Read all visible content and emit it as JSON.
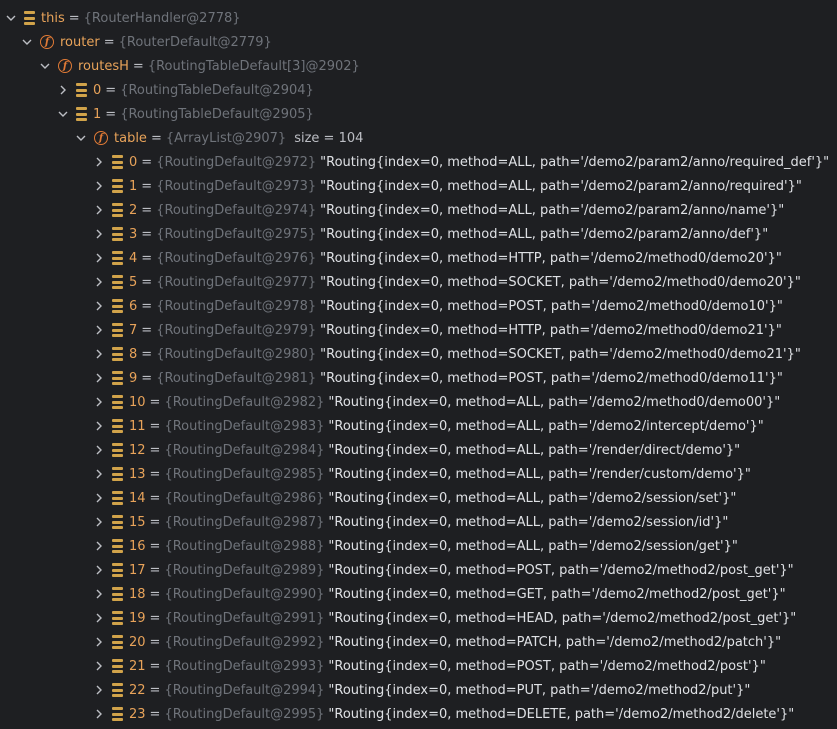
{
  "nodes": [
    {
      "label": "this",
      "ref": "{RouterHandler@2778}"
    },
    {
      "label": "router",
      "ref": "{RouterDefault@2779}"
    },
    {
      "label": "routesH",
      "ref": "{RoutingTableDefault[3]@2902}"
    },
    {
      "label": "0",
      "ref": "{RoutingTableDefault@2904}"
    },
    {
      "label": "1",
      "ref": "{RoutingTableDefault@2905}"
    },
    {
      "label": "table",
      "ref": "{ArrayList@2907}",
      "size": "size = 104"
    }
  ],
  "items": [
    {
      "index": "0",
      "ref": "{RoutingDefault@2972}",
      "value": "\"Routing{index=0, method=ALL, path='/demo2/param2/anno/required_def'}\""
    },
    {
      "index": "1",
      "ref": "{RoutingDefault@2973}",
      "value": "\"Routing{index=0, method=ALL, path='/demo2/param2/anno/required'}\""
    },
    {
      "index": "2",
      "ref": "{RoutingDefault@2974}",
      "value": "\"Routing{index=0, method=ALL, path='/demo2/param2/anno/name'}\""
    },
    {
      "index": "3",
      "ref": "{RoutingDefault@2975}",
      "value": "\"Routing{index=0, method=ALL, path='/demo2/param2/anno/def'}\""
    },
    {
      "index": "4",
      "ref": "{RoutingDefault@2976}",
      "value": "\"Routing{index=0, method=HTTP, path='/demo2/method0/demo20'}\""
    },
    {
      "index": "5",
      "ref": "{RoutingDefault@2977}",
      "value": "\"Routing{index=0, method=SOCKET, path='/demo2/method0/demo20'}\""
    },
    {
      "index": "6",
      "ref": "{RoutingDefault@2978}",
      "value": "\"Routing{index=0, method=POST, path='/demo2/method0/demo10'}\""
    },
    {
      "index": "7",
      "ref": "{RoutingDefault@2979}",
      "value": "\"Routing{index=0, method=HTTP, path='/demo2/method0/demo21'}\""
    },
    {
      "index": "8",
      "ref": "{RoutingDefault@2980}",
      "value": "\"Routing{index=0, method=SOCKET, path='/demo2/method0/demo21'}\""
    },
    {
      "index": "9",
      "ref": "{RoutingDefault@2981}",
      "value": "\"Routing{index=0, method=POST, path='/demo2/method0/demo11'}\""
    },
    {
      "index": "10",
      "ref": "{RoutingDefault@2982}",
      "value": "\"Routing{index=0, method=ALL, path='/demo2/method0/demo00'}\""
    },
    {
      "index": "11",
      "ref": "{RoutingDefault@2983}",
      "value": "\"Routing{index=0, method=ALL, path='/demo2/intercept/demo'}\""
    },
    {
      "index": "12",
      "ref": "{RoutingDefault@2984}",
      "value": "\"Routing{index=0, method=ALL, path='/render/direct/demo'}\""
    },
    {
      "index": "13",
      "ref": "{RoutingDefault@2985}",
      "value": "\"Routing{index=0, method=ALL, path='/render/custom/demo'}\""
    },
    {
      "index": "14",
      "ref": "{RoutingDefault@2986}",
      "value": "\"Routing{index=0, method=ALL, path='/demo2/session/set'}\""
    },
    {
      "index": "15",
      "ref": "{RoutingDefault@2987}",
      "value": "\"Routing{index=0, method=ALL, path='/demo2/session/id'}\""
    },
    {
      "index": "16",
      "ref": "{RoutingDefault@2988}",
      "value": "\"Routing{index=0, method=ALL, path='/demo2/session/get'}\""
    },
    {
      "index": "17",
      "ref": "{RoutingDefault@2989}",
      "value": "\"Routing{index=0, method=POST, path='/demo2/method2/post_get'}\""
    },
    {
      "index": "18",
      "ref": "{RoutingDefault@2990}",
      "value": "\"Routing{index=0, method=GET, path='/demo2/method2/post_get'}\""
    },
    {
      "index": "19",
      "ref": "{RoutingDefault@2991}",
      "value": "\"Routing{index=0, method=HEAD, path='/demo2/method2/post_get'}\""
    },
    {
      "index": "20",
      "ref": "{RoutingDefault@2992}",
      "value": "\"Routing{index=0, method=PATCH, path='/demo2/method2/patch'}\""
    },
    {
      "index": "21",
      "ref": "{RoutingDefault@2993}",
      "value": "\"Routing{index=0, method=POST, path='/demo2/method2/post'}\""
    },
    {
      "index": "22",
      "ref": "{RoutingDefault@2994}",
      "value": "\"Routing{index=0, method=PUT, path='/demo2/method2/put'}\""
    },
    {
      "index": "23",
      "ref": "{RoutingDefault@2995}",
      "value": "\"Routing{index=0, method=DELETE, path='/demo2/method2/delete'}\""
    }
  ],
  "colors": {
    "background": "#1e1f22",
    "field_icon": "#e07a36",
    "array_icon": "#d1a34a",
    "ref": "#6f737a"
  },
  "icons": {
    "expanded": "chevron-down-icon",
    "collapsed": "chevron-right-icon",
    "field": "field-icon",
    "array": "array-element-icon"
  }
}
